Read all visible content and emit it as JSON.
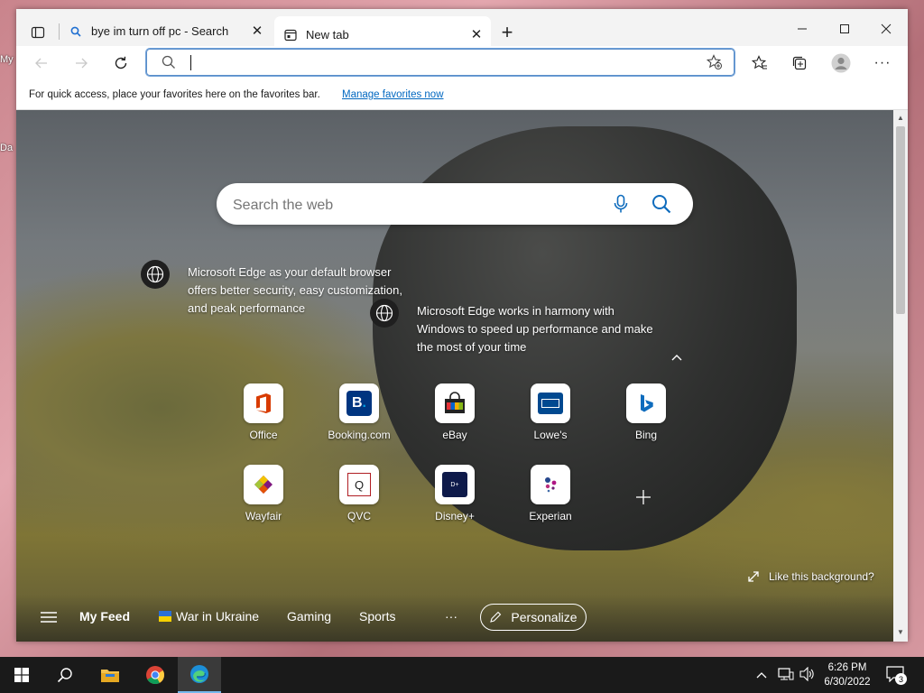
{
  "desktop": {
    "labels": [
      "My",
      "Da"
    ]
  },
  "browser": {
    "tabs": [
      {
        "label": "bye im turn off pc - Search",
        "icon": "search-icon",
        "active": false
      },
      {
        "label": "New tab",
        "icon": "newtab-icon",
        "active": true
      }
    ],
    "new_tab_symbol": "+",
    "address": {
      "value": "",
      "placeholder": ""
    },
    "favorites_bar": {
      "message": "For quick access, place your favorites here on the favorites bar.",
      "link": "Manage favorites now"
    },
    "accent": "#0067c0"
  },
  "newtab": {
    "search": {
      "placeholder": "Search the web"
    },
    "promos": [
      {
        "text": "Microsoft Edge as your default browser offers better security, easy customization, and peak performance"
      },
      {
        "text": "Microsoft Edge works in harmony with Windows to speed up performance and make the most of your time"
      }
    ],
    "quick_links": [
      {
        "label": "Office",
        "icon": "office-icon"
      },
      {
        "label": "Booking.com",
        "icon": "booking-icon"
      },
      {
        "label": "eBay",
        "icon": "ebay-icon"
      },
      {
        "label": "Lowe's",
        "icon": "lowes-icon"
      },
      {
        "label": "Bing",
        "icon": "bing-icon"
      },
      {
        "label": "Wayfair",
        "icon": "wayfair-icon"
      },
      {
        "label": "QVC",
        "icon": "qvc-icon"
      },
      {
        "label": "Disney+",
        "icon": "disney-icon"
      },
      {
        "label": "Experian",
        "icon": "experian-icon"
      }
    ],
    "like_background": "Like this background?",
    "feed": {
      "items": [
        "My Feed",
        "War in Ukraine",
        "Gaming",
        "Sports",
        "···"
      ],
      "personalize": "Personalize"
    }
  },
  "taskbar": {
    "time": "6:26 PM",
    "date": "6/30/2022",
    "notifications": "3"
  }
}
